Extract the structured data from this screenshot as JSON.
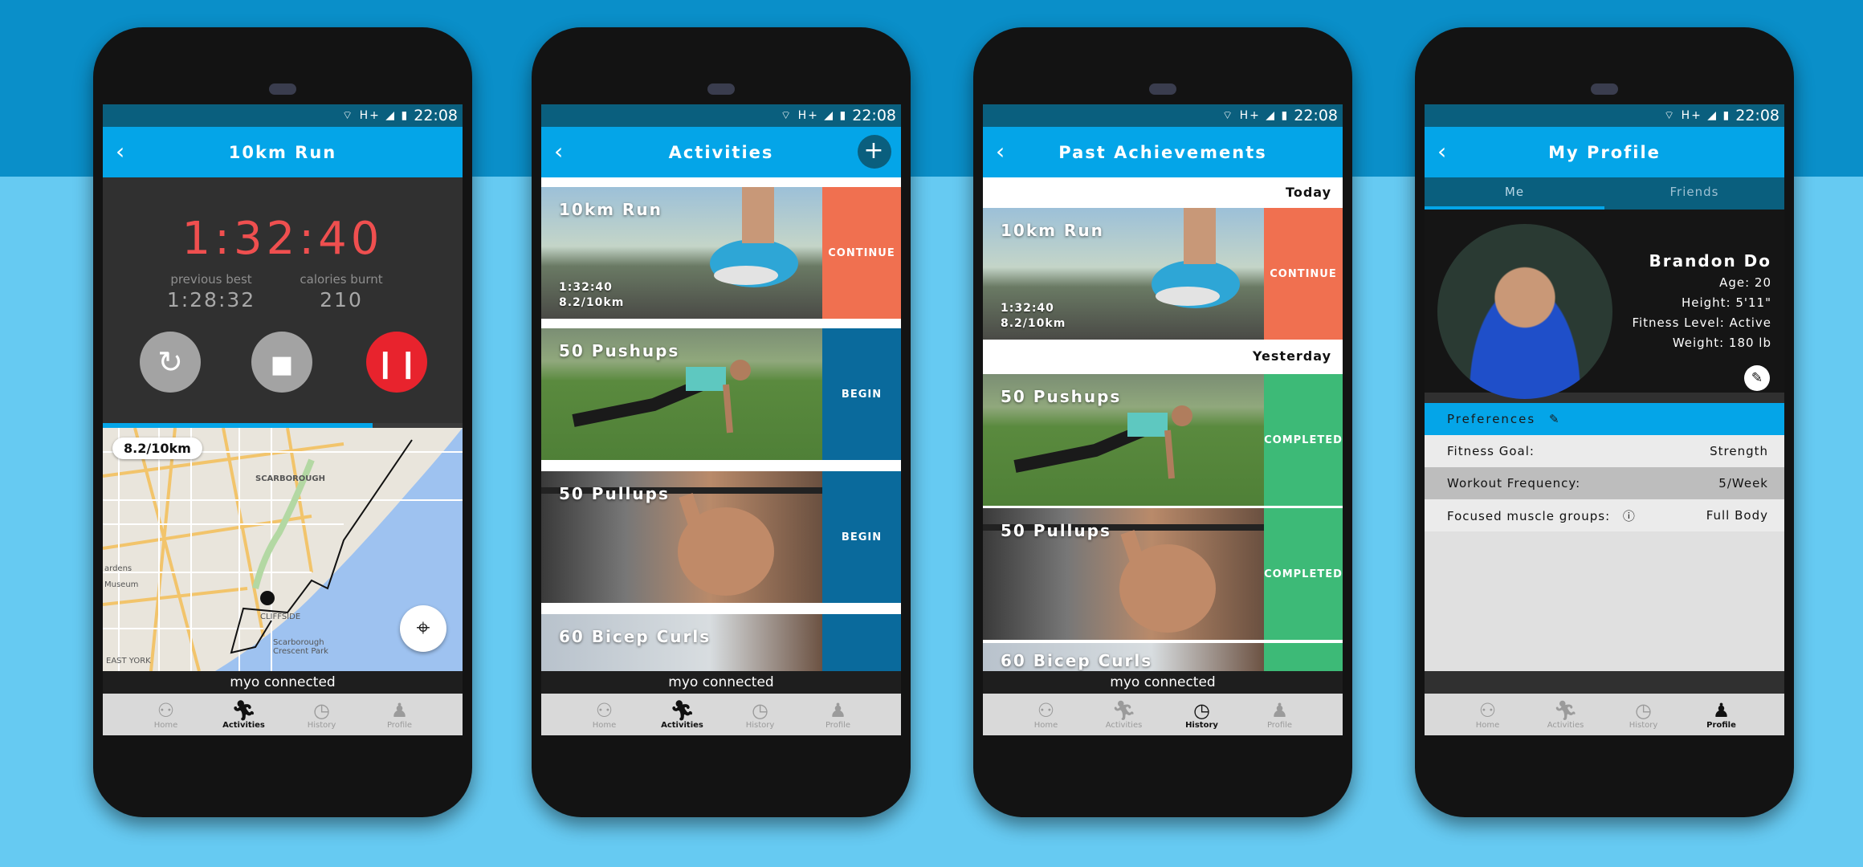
{
  "status_time": "22:08",
  "status_icons": "⌔ H+ ◢ ▮",
  "myo_text": "myo connected",
  "nav": {
    "home": "Home",
    "activities": "Activities",
    "history": "History",
    "profile": "Profile"
  },
  "run_screen": {
    "title": "10km Run",
    "timer": "1:32:40",
    "previous_best_label": "previous best",
    "previous_best_value": "1:28:32",
    "calories_label": "calories burnt",
    "calories_value": "210",
    "progress_fraction": 0.75,
    "distance_pill": "8.2/10km",
    "map_labels": [
      "SCARBOROUGH",
      "EAST YORK",
      "Scarborough Crescent Park",
      "Museum",
      "ardens",
      "CLIFFSIDE"
    ]
  },
  "activities_screen": {
    "title": "Activities",
    "add_icon": "+",
    "cards": [
      {
        "title": "10km Run",
        "stat1": "1:32:40",
        "stat2": "8.2/10km",
        "action": "CONTINUE",
        "color": "#f07050"
      },
      {
        "title": "50 Pushups",
        "stat1": "",
        "stat2": "",
        "action": "BEGIN",
        "color": "#0a6a9c"
      },
      {
        "title": "50 Pullups",
        "stat1": "",
        "stat2": "",
        "action": "BEGIN",
        "color": "#0a6a9c"
      },
      {
        "title": "60 Bicep Curls",
        "stat1": "",
        "stat2": "",
        "action": "",
        "color": "#0a6a9c"
      }
    ]
  },
  "history_screen": {
    "title": "Past Achievements",
    "today_label": "Today",
    "yesterday_label": "Yesterday",
    "cards": [
      {
        "title": "10km Run",
        "stat1": "1:32:40",
        "stat2": "8.2/10km",
        "action": "CONTINUE",
        "color": "#f07050"
      },
      {
        "title": "50 Pushups",
        "action": "COMPLETED",
        "color": "#3dba77"
      },
      {
        "title": "50 Pullups",
        "action": "COMPLETED",
        "color": "#3dba77"
      },
      {
        "title": "60 Bicep Curls",
        "action": "",
        "color": "#3dba77"
      }
    ]
  },
  "profile_screen": {
    "title": "My Profile",
    "tab_me": "Me",
    "tab_friends": "Friends",
    "name": "Brandon Do",
    "age": "Age: 20",
    "height": "Height: 5'11\"",
    "fitness_level": "Fitness Level: Active",
    "weight": "Weight: 180 lb",
    "preferences_label": "Preferences",
    "prefs": [
      {
        "label": "Fitness Goal:",
        "value": "Strength"
      },
      {
        "label": "Workout Frequency:",
        "value": "5/Week"
      },
      {
        "label": "Focused muscle groups:",
        "value": "Full Body"
      }
    ]
  }
}
